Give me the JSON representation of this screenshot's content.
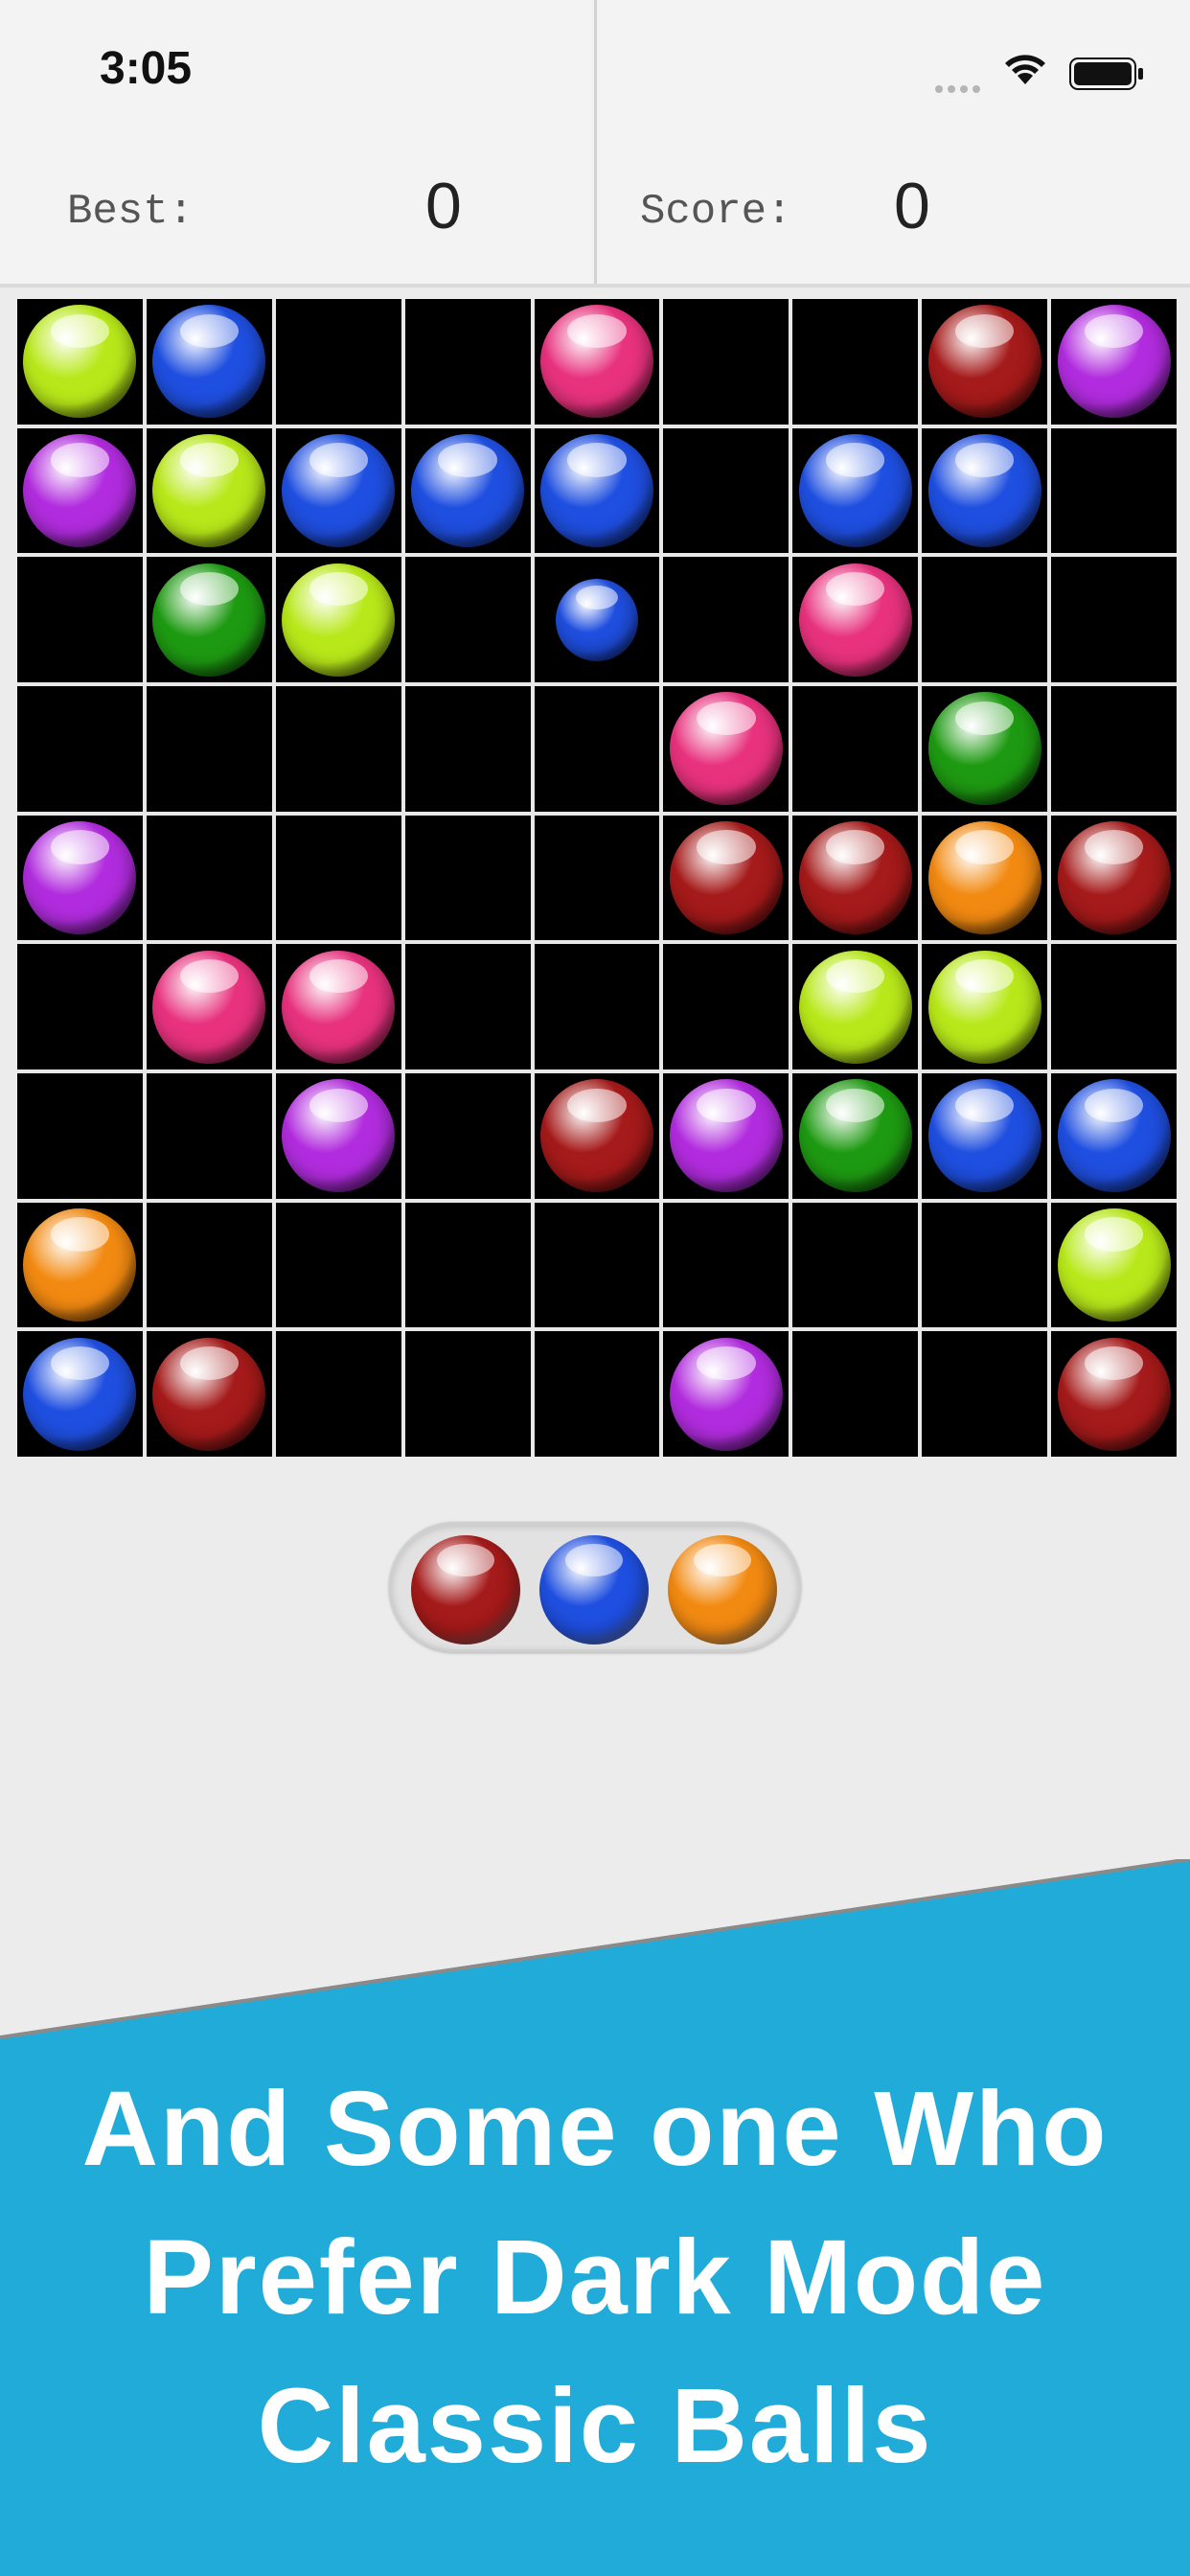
{
  "status_bar": {
    "time": "3:05"
  },
  "header": {
    "best_label": "Best:",
    "best_value": "0",
    "score_label": "Score:",
    "score_value": "0"
  },
  "colors": {
    "lime": "#b8e81a",
    "blue": "#1f4fe0",
    "pink": "#e8327e",
    "red": "#a51a1a",
    "purple": "#b12cde",
    "green": "#1e9a12",
    "orange": "#f28a12",
    "banner": "#21abd8"
  },
  "board": {
    "rows": [
      [
        "lime",
        "blue",
        "",
        "",
        "pink",
        "",
        "",
        "red",
        "purple"
      ],
      [
        "purple",
        "lime",
        "blue",
        "blue",
        "blue",
        "",
        "blue",
        "blue",
        ""
      ],
      [
        "",
        "green",
        "lime",
        "",
        "blue-small",
        "",
        "pink",
        "",
        ""
      ],
      [
        "",
        "",
        "",
        "",
        "",
        "pink",
        "",
        "green",
        ""
      ],
      [
        "purple",
        "",
        "",
        "",
        "",
        "red",
        "red",
        "orange",
        "red"
      ],
      [
        "",
        "pink",
        "pink",
        "",
        "",
        "",
        "lime",
        "lime",
        ""
      ],
      [
        "",
        "",
        "purple",
        "",
        "red",
        "purple",
        "green",
        "blue",
        "blue"
      ],
      [
        "orange",
        "",
        "",
        "",
        "",
        "",
        "",
        "",
        "lime"
      ],
      [
        "blue",
        "red",
        "",
        "",
        "",
        "purple",
        "",
        "",
        "red"
      ]
    ]
  },
  "next_balls": [
    "red",
    "blue",
    "orange"
  ],
  "banner": {
    "line1": "And Some one Who",
    "line2": "Prefer Dark Mode",
    "line3": "Classic Balls"
  }
}
